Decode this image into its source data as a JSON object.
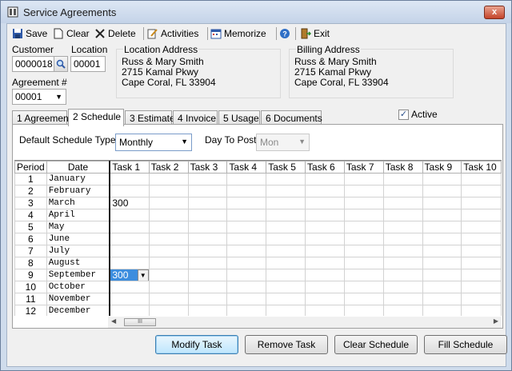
{
  "window": {
    "title": "Service Agreements",
    "close": "x"
  },
  "toolbar": {
    "save": "Save",
    "clear": "Clear",
    "delete": "Delete",
    "activities": "Activities",
    "memorize": "Memorize",
    "help": "?",
    "exit": "Exit"
  },
  "header": {
    "customer_label": "Customer",
    "customer_value": "0000018",
    "location_label": "Location",
    "location_value": "00001",
    "agreement_label": "Agreement #",
    "agreement_value": "00001",
    "location_address": {
      "label": "Location Address",
      "line1": "Russ & Mary Smith",
      "line2": "2715 Kamal Pkwy",
      "line3": "Cape Coral, FL  33904"
    },
    "billing_address": {
      "label": "Billing Address",
      "line1": "Russ & Mary Smith",
      "line2": "2715 Kamal Pkwy",
      "line3": "Cape Coral, FL  33904"
    },
    "active_label": "Active",
    "active_checked": true
  },
  "tabs": [
    "1 Agreement",
    "2 Schedule",
    "3 Estimate",
    "4 Invoice",
    "5 Usage",
    "6 Documents"
  ],
  "active_tab": "2 Schedule",
  "schedule": {
    "default_type_label": "Default Schedule Type",
    "default_type_value": "Monthly",
    "day_to_post_label": "Day To Post",
    "day_to_post_value": "Mon"
  },
  "grid": {
    "col_period": "Period",
    "col_date": "Date",
    "task_cols": [
      "Task 1",
      "Task 2",
      "Task 3",
      "Task 4",
      "Task 5",
      "Task 6",
      "Task 7",
      "Task 8",
      "Task 9",
      "Task 10"
    ],
    "rows": [
      {
        "period": "1",
        "date": "January",
        "task1": ""
      },
      {
        "period": "2",
        "date": "February",
        "task1": ""
      },
      {
        "period": "3",
        "date": "March",
        "task1": "300"
      },
      {
        "period": "4",
        "date": "April",
        "task1": ""
      },
      {
        "period": "5",
        "date": "May",
        "task1": ""
      },
      {
        "period": "6",
        "date": "June",
        "task1": ""
      },
      {
        "period": "7",
        "date": "July",
        "task1": ""
      },
      {
        "period": "8",
        "date": "August",
        "task1": ""
      },
      {
        "period": "9",
        "date": "September",
        "task1": "300"
      },
      {
        "period": "10",
        "date": "October",
        "task1": ""
      },
      {
        "period": "11",
        "date": "November",
        "task1": ""
      },
      {
        "period": "12",
        "date": "December",
        "task1": ""
      }
    ],
    "scroll_thumb": "III"
  },
  "buttons": {
    "modify_task": "Modify Task",
    "remove_task": "Remove Task",
    "clear_schedule": "Clear Schedule",
    "fill_schedule": "Fill Schedule"
  }
}
